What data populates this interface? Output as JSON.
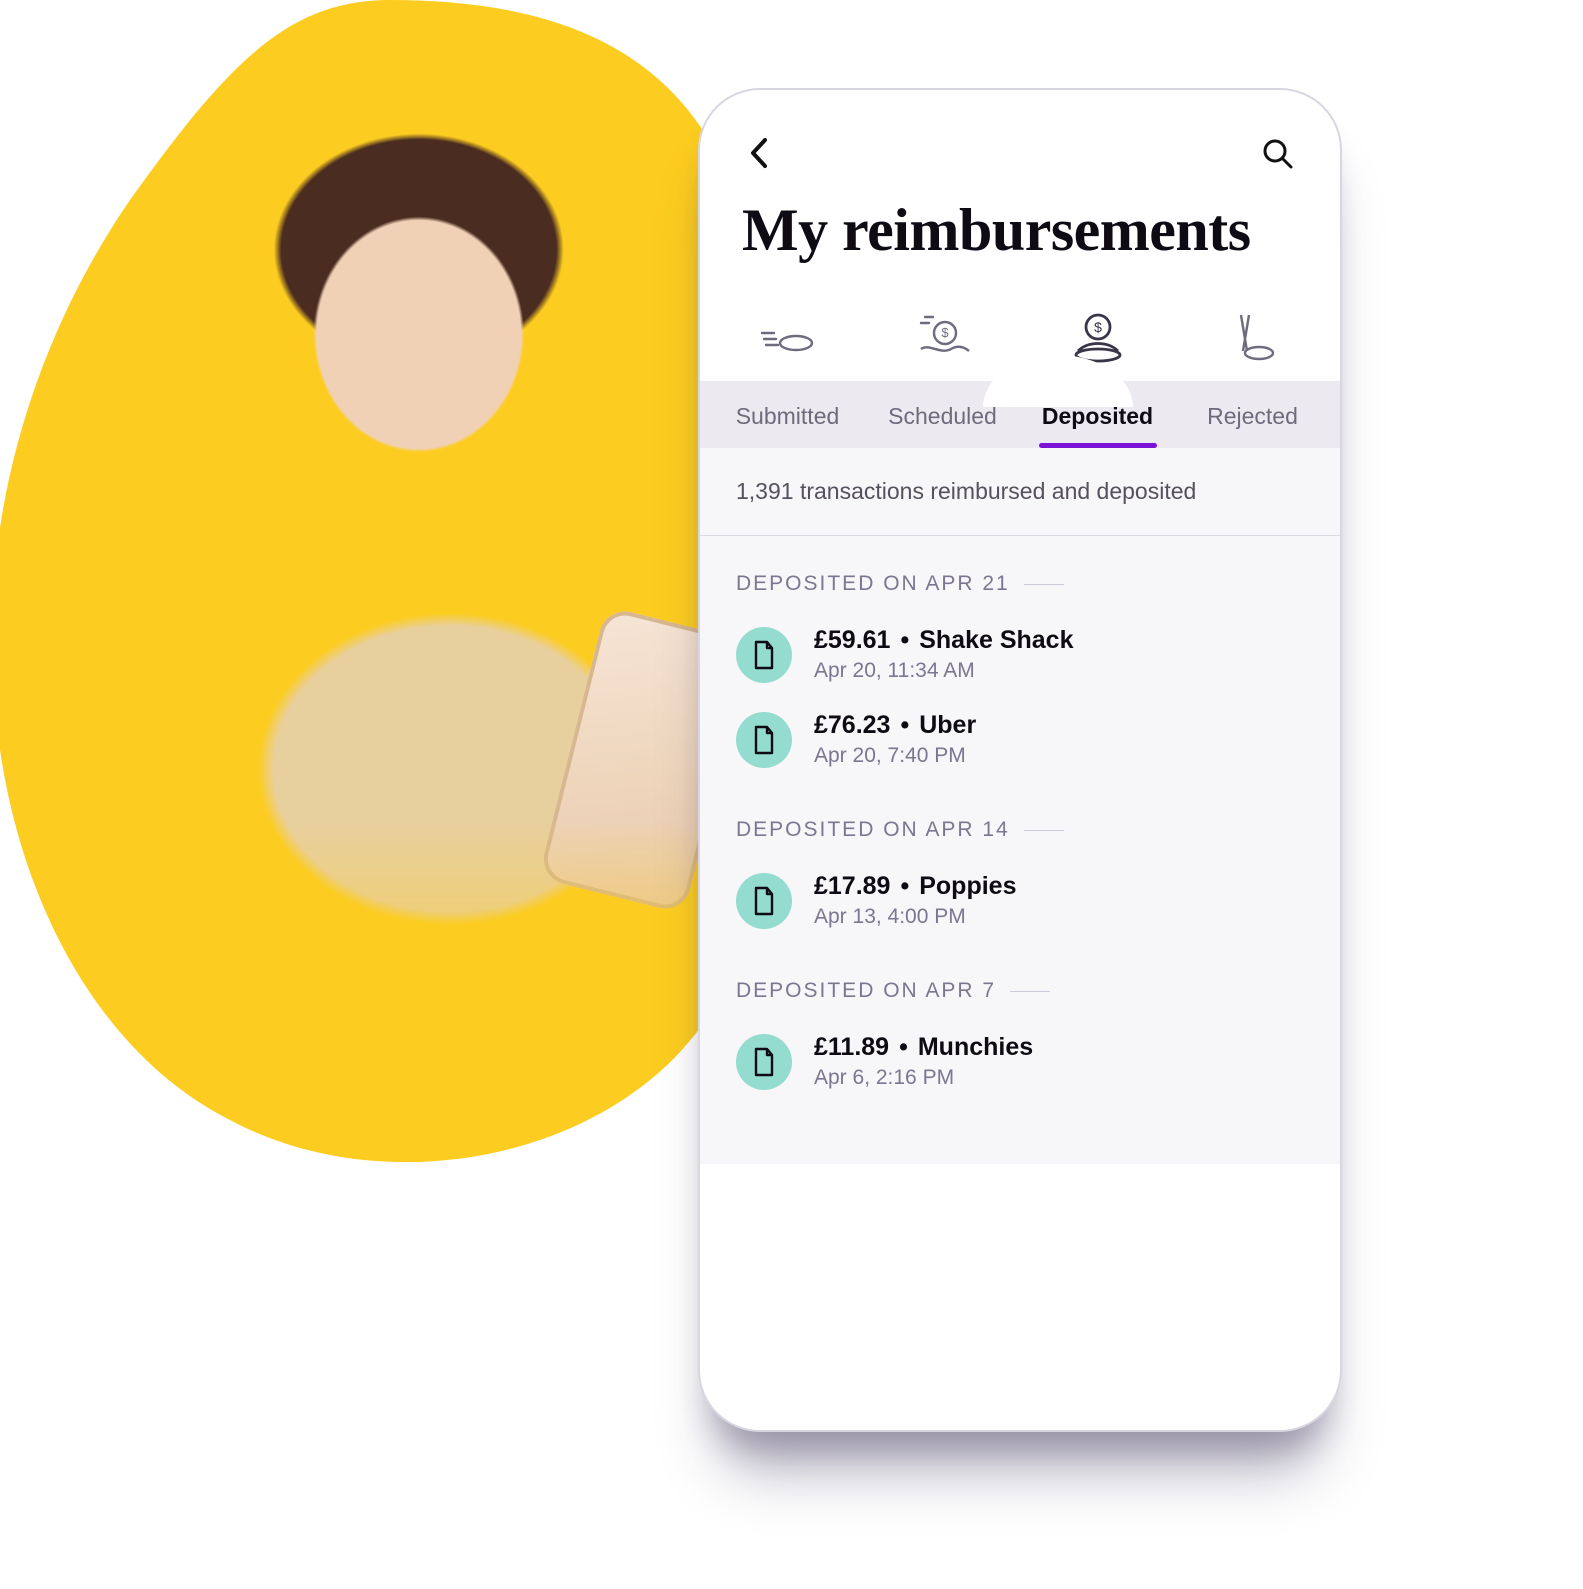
{
  "page": {
    "title": "My reimbursements"
  },
  "tabs": [
    {
      "label": "Submitted",
      "active": false
    },
    {
      "label": "Scheduled",
      "active": false
    },
    {
      "label": "Deposited",
      "active": true
    },
    {
      "label": "Rejected",
      "active": false
    }
  ],
  "summary": "1,391 transactions reimbursed and deposited",
  "currency_symbol": "£",
  "groups": [
    {
      "header": "DEPOSITED ON APR 21",
      "items": [
        {
          "amount": "£59.61",
          "merchant": "Shake Shack",
          "time": "Apr 20, 11:34 AM"
        },
        {
          "amount": "£76.23",
          "merchant": "Uber",
          "time": "Apr 20,  7:40 PM"
        }
      ]
    },
    {
      "header": "DEPOSITED ON APR 14",
      "items": [
        {
          "amount": "£17.89",
          "merchant": "Poppies",
          "time": "Apr 13, 4:00 PM"
        }
      ]
    },
    {
      "header": "DEPOSITED ON APR 7",
      "items": [
        {
          "amount": "£11.89",
          "merchant": "Munchies",
          "time": "Apr 6,  2:16 PM"
        }
      ]
    }
  ],
  "colors": {
    "accent_yellow": "#FCCD20",
    "accent_purple": "#7a13d6",
    "chip_teal": "#93dccf"
  }
}
